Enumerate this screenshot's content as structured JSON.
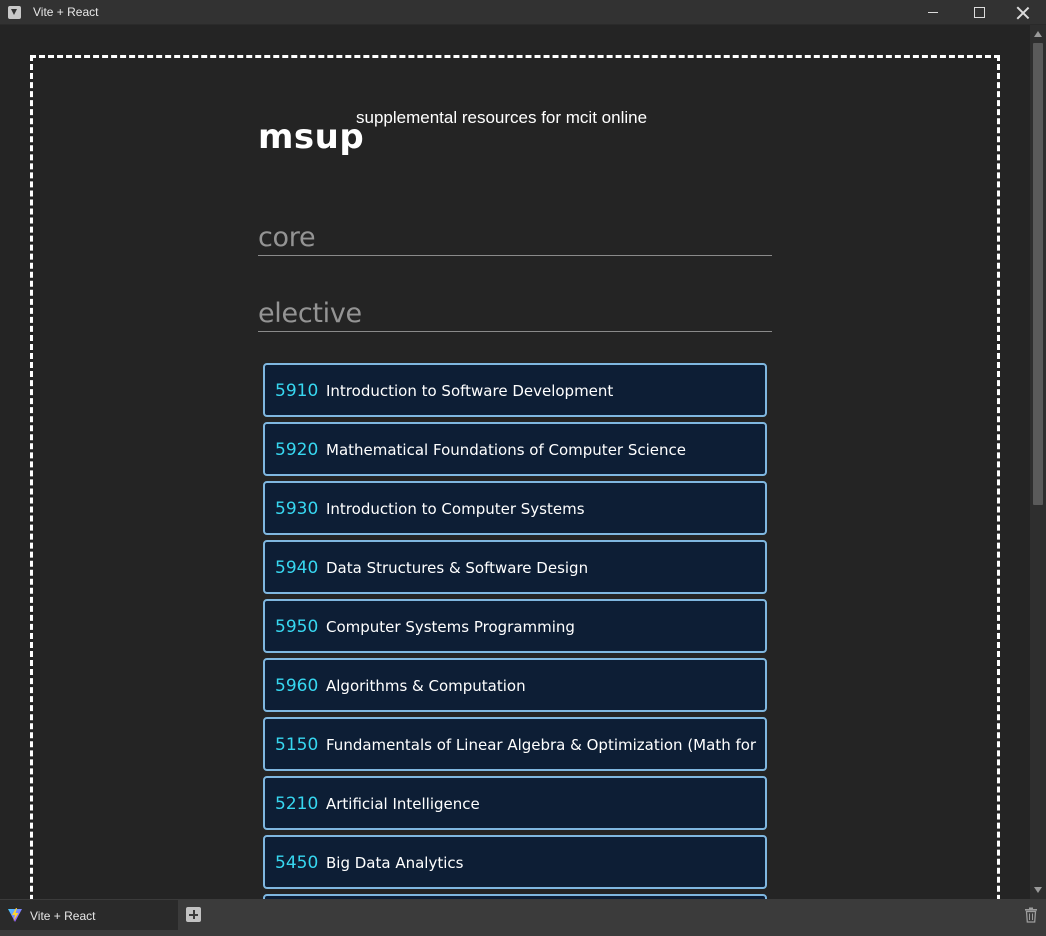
{
  "window": {
    "title": "Vite + React"
  },
  "header": {
    "brand": "msup",
    "tagline": "supplemental resources for mcit online"
  },
  "sections": {
    "core": "core",
    "elective": "elective"
  },
  "courses": [
    {
      "number": "5910",
      "name": "Introduction to Software Development"
    },
    {
      "number": "5920",
      "name": "Mathematical Foundations of Computer Science"
    },
    {
      "number": "5930",
      "name": "Introduction to Computer Systems"
    },
    {
      "number": "5940",
      "name": "Data Structures & Software Design"
    },
    {
      "number": "5950",
      "name": "Computer Systems Programming"
    },
    {
      "number": "5960",
      "name": "Algorithms & Computation"
    },
    {
      "number": "5150",
      "name": " Fundamentals of Linear Algebra & Optimization (Math for"
    },
    {
      "number": "5210",
      "name": "Artificial Intelligence"
    },
    {
      "number": "5450",
      "name": "Big Data Analytics"
    }
  ],
  "tabbar": {
    "tab_title": "Vite + React"
  },
  "colors": {
    "background": "#242424",
    "card_bg": "#0d1e35",
    "card_border": "#7fb7e0",
    "course_number": "#37d7f0"
  },
  "icons": {
    "app": "vite-logo-icon",
    "new_tab": "plus-icon",
    "trash": "trash-icon"
  }
}
